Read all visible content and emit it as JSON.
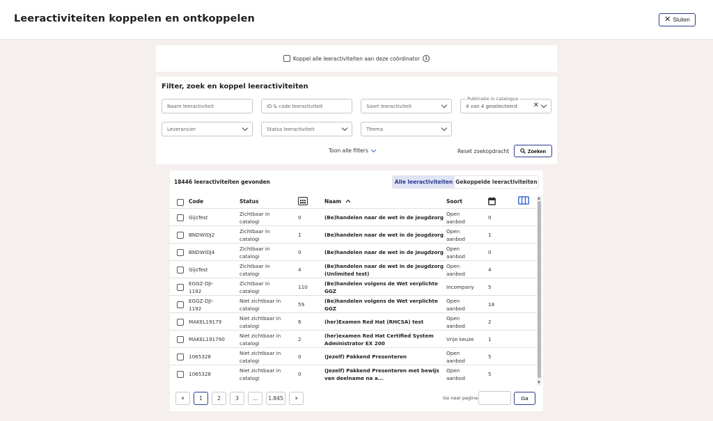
{
  "header": {
    "title": "Leeractiviteiten koppelen en ontkoppelen",
    "close_label": "Sluiten"
  },
  "link_all": {
    "label": "Koppel alle leeractiviteiten aan deze coördinator"
  },
  "filter": {
    "title": "Filter, zoek en koppel leeractiviteiten",
    "name_placeholder": "Naam leeractiviteit",
    "id_placeholder": "ID & code leeractiviteit",
    "type_placeholder": "Soort leeractiviteit",
    "publication_legend": "Publicatie in catalogus",
    "publication_value": "4 van 4 geselecteerd",
    "supplier_placeholder": "Leverancier",
    "status_placeholder": "Status leeractiviteit",
    "theme_placeholder": "Thema",
    "show_all_filters": "Toon alle filters",
    "reset": "Reset zoekopdracht",
    "search": "Zoeken"
  },
  "results": {
    "count_text": "18446 leeractiviteiten gevonden",
    "toggle_all": "Alle leeractiviteiten",
    "toggle_linked": "Gekoppelde leeractiviteiten",
    "columns": {
      "code": "Code",
      "status": "Status",
      "name": "Naam",
      "type": "Soort"
    },
    "rows": [
      {
        "code": [
          "GijsTest"
        ],
        "status": [
          "Zichtbaar in",
          "catalogi"
        ],
        "count": "0",
        "name": [
          "(Be)handelen naar de wet in de jeugdzorg"
        ],
        "type": [
          "Open",
          "aanbod"
        ],
        "days": "0"
      },
      {
        "code": [
          "BNDWIDJ2"
        ],
        "status": [
          "Zichtbaar in",
          "catalogi"
        ],
        "count": "1",
        "name": [
          "(Be)handelen naar de wet in de jeugdzorg"
        ],
        "type": [
          "Open",
          "aanbod"
        ],
        "days": "1"
      },
      {
        "code": [
          "BNDWIDJ4"
        ],
        "status": [
          "Zichtbaar in",
          "catalogi"
        ],
        "count": "0",
        "name": [
          "(Be)handelen naar de wet in de jeugdzorg"
        ],
        "type": [
          "Open",
          "aanbod"
        ],
        "days": "0"
      },
      {
        "code": [
          "GijsTest"
        ],
        "status": [
          "Zichtbaar in",
          "catalogi"
        ],
        "count": "4",
        "name": [
          "(Be)handelen naar de wet in de jeugdzorg",
          "(Unlimited test)"
        ],
        "type": [
          "Open",
          "aanbod"
        ],
        "days": "4"
      },
      {
        "code": [
          "EGGZ-DJI-",
          "1192"
        ],
        "status": [
          "Zichtbaar in",
          "catalogi"
        ],
        "count": "110",
        "name": [
          "(Be)handelen volgens de Wet verplichte",
          "GGZ"
        ],
        "type": [
          "Incompany"
        ],
        "days": "5"
      },
      {
        "code": [
          "EGGZ-DJI-",
          "1192"
        ],
        "status": [
          "Niet zichtbaar in",
          "catalogi"
        ],
        "count": "59",
        "name": [
          "(Be)handelen volgens de Wet verplichte",
          "GGZ"
        ],
        "type": [
          "Open",
          "aanbod"
        ],
        "days": "18"
      },
      {
        "code": [
          "MAKEL19179"
        ],
        "status": [
          "Niet zichtbaar in",
          "catalogi"
        ],
        "count": "6",
        "name": [
          "(her)Examen Red Hat (RHCSA) test"
        ],
        "type": [
          "Open",
          "aanbod"
        ],
        "days": "2"
      },
      {
        "code": [
          "MAKEL191790"
        ],
        "status": [
          "Niet zichtbaar in",
          "catalogi"
        ],
        "count": "2",
        "name": [
          "(her)examen Red Hat Certified System",
          "Administrator EX 200"
        ],
        "type": [
          "Vrije keuze"
        ],
        "days": "1"
      },
      {
        "code": [
          "1065328"
        ],
        "status": [
          "Niet zichtbaar in",
          "catalogi"
        ],
        "count": "0",
        "name": [
          "(Jezelf) Pakkend Presenteren"
        ],
        "type": [
          "Open",
          "aanbod"
        ],
        "days": "5"
      },
      {
        "code": [
          "1065328"
        ],
        "status": [
          "Niet zichtbaar in",
          "catalogi"
        ],
        "count": "0",
        "name": [
          "(Jezelf) Pakkend Presenteren met bewijs",
          "van deelname na a..."
        ],
        "type": [
          "Open",
          "aanbod"
        ],
        "days": "5"
      }
    ]
  },
  "pagination": {
    "pages": [
      "1",
      "2",
      "3",
      "...",
      "1.845"
    ],
    "current": "1",
    "goto_label": "Ga naar pagina",
    "goto_button": "Ga"
  },
  "colors": {
    "accent": "#2b3b8f",
    "toggle_active_bg": "#dfe5f7",
    "page_bg": "#f5efee"
  },
  "icons": [
    "close-icon",
    "info-icon",
    "chevron-down-icon",
    "search-icon",
    "participants-icon",
    "sort-ascending-icon",
    "calendar-icon",
    "columns-icon",
    "chevron-left-icon",
    "chevron-right-icon"
  ]
}
